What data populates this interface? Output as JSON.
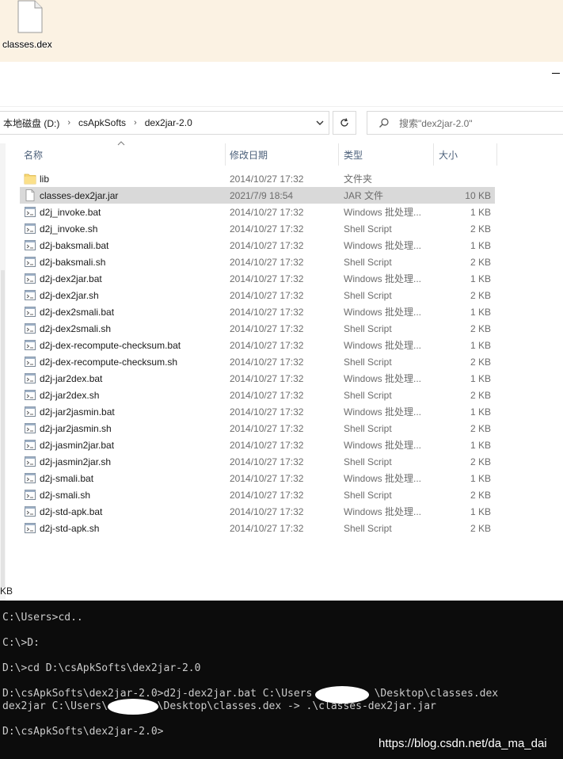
{
  "desktop": {
    "file_label": "classes.dex"
  },
  "explorer": {
    "breadcrumb": [
      "本地磁盘 (D:)",
      "csApkSofts",
      "dex2jar-2.0"
    ],
    "search_placeholder": "搜索\"dex2jar-2.0\"",
    "columns": {
      "name": "名称",
      "date": "修改日期",
      "type": "类型",
      "size": "大小"
    },
    "files": [
      {
        "name": "lib",
        "date": "2014/10/27 17:32",
        "type": "文件夹",
        "size": "",
        "icon": "folder-icon"
      },
      {
        "name": "classes-dex2jar.jar",
        "date": "2021/7/9 18:54",
        "type": "JAR 文件",
        "size": "10 KB",
        "icon": "file-icon",
        "selected": true
      },
      {
        "name": "d2j_invoke.bat",
        "date": "2014/10/27 17:32",
        "type": "Windows 批处理...",
        "size": "1 KB",
        "icon": "script-icon"
      },
      {
        "name": "d2j_invoke.sh",
        "date": "2014/10/27 17:32",
        "type": "Shell Script",
        "size": "2 KB",
        "icon": "script-icon"
      },
      {
        "name": "d2j-baksmali.bat",
        "date": "2014/10/27 17:32",
        "type": "Windows 批处理...",
        "size": "1 KB",
        "icon": "script-icon"
      },
      {
        "name": "d2j-baksmali.sh",
        "date": "2014/10/27 17:32",
        "type": "Shell Script",
        "size": "2 KB",
        "icon": "script-icon"
      },
      {
        "name": "d2j-dex2jar.bat",
        "date": "2014/10/27 17:32",
        "type": "Windows 批处理...",
        "size": "1 KB",
        "icon": "script-icon"
      },
      {
        "name": "d2j-dex2jar.sh",
        "date": "2014/10/27 17:32",
        "type": "Shell Script",
        "size": "2 KB",
        "icon": "script-icon"
      },
      {
        "name": "d2j-dex2smali.bat",
        "date": "2014/10/27 17:32",
        "type": "Windows 批处理...",
        "size": "1 KB",
        "icon": "script-icon"
      },
      {
        "name": "d2j-dex2smali.sh",
        "date": "2014/10/27 17:32",
        "type": "Shell Script",
        "size": "2 KB",
        "icon": "script-icon"
      },
      {
        "name": "d2j-dex-recompute-checksum.bat",
        "date": "2014/10/27 17:32",
        "type": "Windows 批处理...",
        "size": "1 KB",
        "icon": "script-icon"
      },
      {
        "name": "d2j-dex-recompute-checksum.sh",
        "date": "2014/10/27 17:32",
        "type": "Shell Script",
        "size": "2 KB",
        "icon": "script-icon"
      },
      {
        "name": "d2j-jar2dex.bat",
        "date": "2014/10/27 17:32",
        "type": "Windows 批处理...",
        "size": "1 KB",
        "icon": "script-icon"
      },
      {
        "name": "d2j-jar2dex.sh",
        "date": "2014/10/27 17:32",
        "type": "Shell Script",
        "size": "2 KB",
        "icon": "script-icon"
      },
      {
        "name": "d2j-jar2jasmin.bat",
        "date": "2014/10/27 17:32",
        "type": "Windows 批处理...",
        "size": "1 KB",
        "icon": "script-icon"
      },
      {
        "name": "d2j-jar2jasmin.sh",
        "date": "2014/10/27 17:32",
        "type": "Shell Script",
        "size": "2 KB",
        "icon": "script-icon"
      },
      {
        "name": "d2j-jasmin2jar.bat",
        "date": "2014/10/27 17:32",
        "type": "Windows 批处理...",
        "size": "1 KB",
        "icon": "script-icon"
      },
      {
        "name": "d2j-jasmin2jar.sh",
        "date": "2014/10/27 17:32",
        "type": "Shell Script",
        "size": "2 KB",
        "icon": "script-icon"
      },
      {
        "name": "d2j-smali.bat",
        "date": "2014/10/27 17:32",
        "type": "Windows 批处理...",
        "size": "1 KB",
        "icon": "script-icon"
      },
      {
        "name": "d2j-smali.sh",
        "date": "2014/10/27 17:32",
        "type": "Shell Script",
        "size": "2 KB",
        "icon": "script-icon"
      },
      {
        "name": "d2j-std-apk.bat",
        "date": "2014/10/27 17:32",
        "type": "Windows 批处理...",
        "size": "1 KB",
        "icon": "script-icon"
      },
      {
        "name": "d2j-std-apk.sh",
        "date": "2014/10/27 17:32",
        "type": "Shell Script",
        "size": "2 KB",
        "icon": "script-icon"
      }
    ],
    "status_fragment": "KB"
  },
  "console": {
    "lines": [
      "C:\\Users>cd..",
      "",
      "C:\\>D:",
      "",
      "D:\\>cd D:\\csApkSofts\\dex2jar-2.0",
      "",
      "D:\\csApkSofts\\dex2jar-2.0>d2j-dex2jar.bat C:\\Users          \\Desktop\\classes.dex",
      "dex2jar C:\\Users\\        \\Desktop\\classes.dex -> .\\classes-dex2jar.jar",
      "",
      "D:\\csApkSofts\\dex2jar-2.0>"
    ]
  },
  "watermark": "https://blog.csdn.net/da_ma_dai"
}
